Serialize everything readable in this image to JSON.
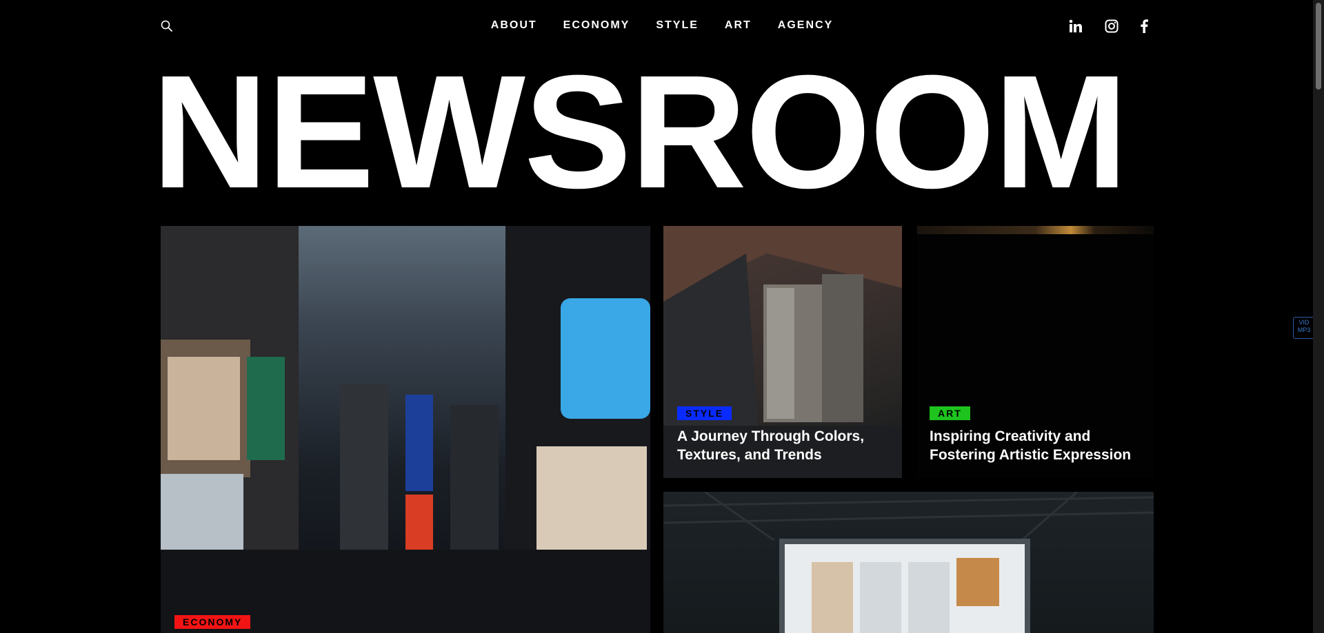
{
  "header": {
    "nav": [
      "ABOUT",
      "ECONOMY",
      "STYLE",
      "ART",
      "AGENCY"
    ]
  },
  "masthead": "NEWSROOM",
  "cards": {
    "economy": {
      "tag": "ECONOMY",
      "tag_color": "#f21414"
    },
    "style": {
      "tag": "STYLE",
      "tag_color": "#0a2bff",
      "title": "A Journey Through Colors, Textures, and Trends"
    },
    "art": {
      "tag": "ART",
      "tag_color": "#1ec31e",
      "title": "Inspiring Creativity and Fostering Artistic Expression"
    }
  },
  "side_widget": {
    "line1": "VID",
    "line2": "MP3"
  }
}
